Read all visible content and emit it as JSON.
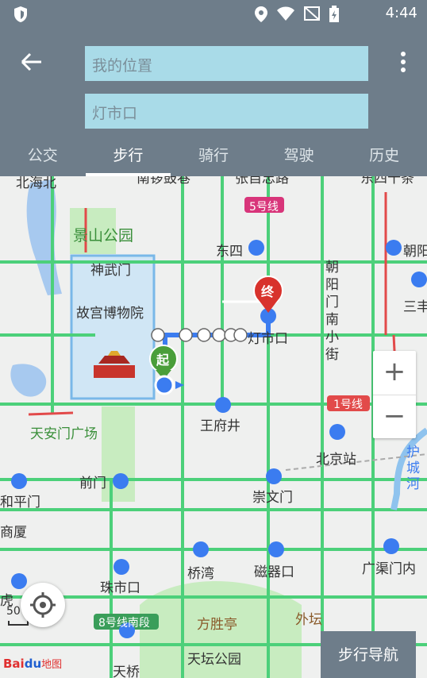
{
  "status_bar": {
    "time": "4:44"
  },
  "search": {
    "from_placeholder": "我的位置",
    "to_value": "灯市口"
  },
  "tabs": [
    {
      "label": "公交"
    },
    {
      "label": "步行"
    },
    {
      "label": "骑行"
    },
    {
      "label": "驾驶"
    },
    {
      "label": "历史"
    }
  ],
  "map": {
    "labels": {
      "beihaibei": "北海北",
      "nanluogu": "南锣鼓巷",
      "zhangzizhong": "张自忠路",
      "dongsishitiao": "东四十条",
      "line5": "5号线",
      "jingshan": "景山公园",
      "dongsi": "东四",
      "chaoyang": "朝阳",
      "shenwumen": "神武门",
      "chaoyangmennan": "朝阳门南小街",
      "gugong": "故宫博物院",
      "sanfeng": "三丰",
      "dengshikou": "灯市口",
      "line1": "1号线",
      "wangfujing": "王府井",
      "tiananmen": "天安门广场",
      "beijingzhan": "北京站",
      "huchenghe": "护城河",
      "qianmen": "前门",
      "hepingmen": "和平门",
      "chongwenmen": "崇文门",
      "shangxia": "商厦",
      "guangqumennei": "广渠门内",
      "zhushikou": "珠市口",
      "qiaowan": "桥湾",
      "ciqikou": "磁器口",
      "hu": "虎",
      "line8": "8号线南段",
      "fangshengting": "方胜亭",
      "waitan": "外坛",
      "tianqiao": "天桥",
      "tiantan": "天坛公园",
      "start_marker": "起",
      "end_marker": "终",
      "scale": "50"
    }
  },
  "zoom": {
    "in": "+",
    "out": "−"
  },
  "nav_button": "步行导航",
  "logo": {
    "brand": "Bai",
    "paw": "du",
    "sub": "地图"
  }
}
